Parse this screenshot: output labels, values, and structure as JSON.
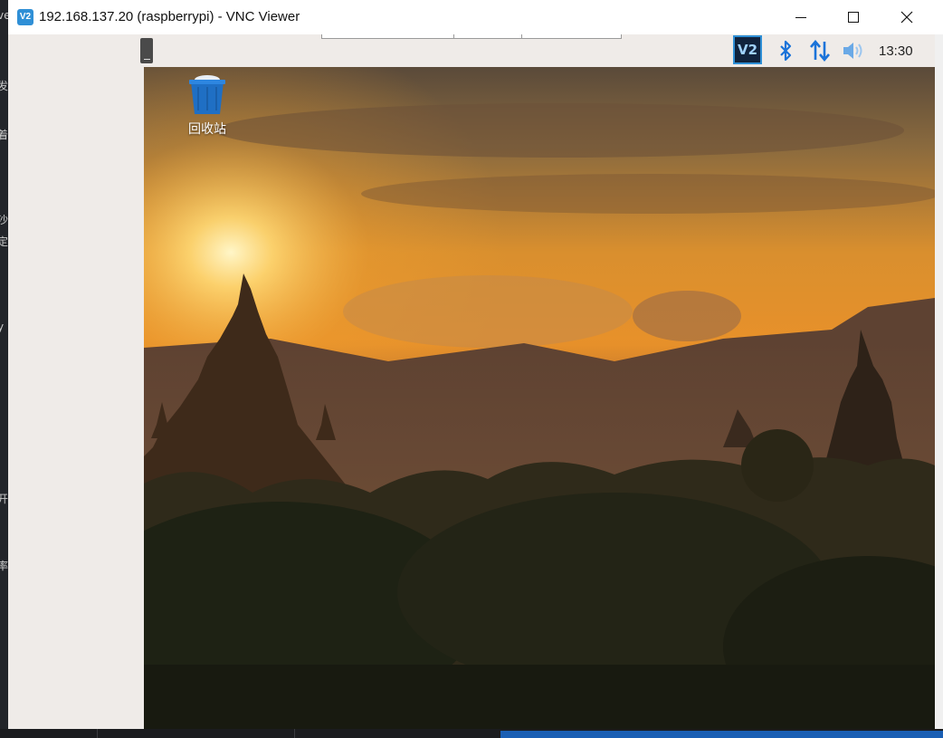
{
  "window": {
    "title": "192.168.137.20 (raspberrypi) - VNC Viewer",
    "app_icon_text": "V2"
  },
  "panel": {
    "tray_vnc_text": "V2",
    "clock": "13:30"
  },
  "desktop": {
    "trash_label": "回收站"
  },
  "host_fragments": [
    "ve",
    "发",
    "着",
    "沙",
    "定",
    "y",
    "开",
    "率"
  ],
  "colors": {
    "titlebar": "#ffffff",
    "panel": "#efebe8",
    "accent": "#2f8fd6",
    "taskbar_blue": "#1a5fb4"
  }
}
